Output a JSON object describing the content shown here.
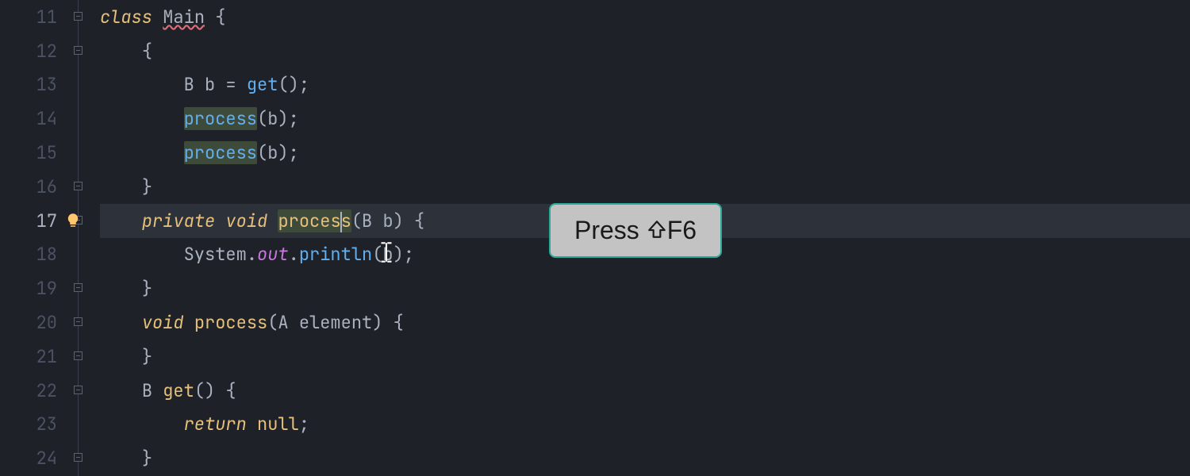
{
  "gutter": {
    "lines": [
      "11",
      "12",
      "13",
      "14",
      "15",
      "16",
      "17",
      "18",
      "19",
      "20",
      "21",
      "22",
      "23",
      "24"
    ]
  },
  "code": {
    "l11": {
      "kw_class": "class",
      "name": "Main",
      "brace": " {"
    },
    "l12": {
      "indent": "    ",
      "brace": "{"
    },
    "l13": {
      "indent": "        ",
      "type": "B",
      "sp1": " ",
      "var": "b",
      "eq": " = ",
      "call": "get",
      "rest": "();"
    },
    "l14": {
      "indent": "        ",
      "call": "process",
      "args": "(b);"
    },
    "l15": {
      "indent": "        ",
      "call": "process",
      "args": "(b);"
    },
    "l16": {
      "indent": "    ",
      "brace": "}"
    },
    "l17": {
      "indent": "    ",
      "kw_priv": "private",
      "sp1": " ",
      "kw_void": "void",
      "sp2": " ",
      "name_a": "proces",
      "name_b": "s",
      "params": "(B b) {"
    },
    "l18": {
      "indent": "        ",
      "sys": "System",
      "dot1": ".",
      "out": "out",
      "dot2": ".",
      "call": "println",
      "args": "(b);"
    },
    "l19": {
      "indent": "    ",
      "brace": "}"
    },
    "l20": {
      "indent": "    ",
      "kw_void": "void",
      "sp1": " ",
      "name": "process",
      "params": "(A element) {"
    },
    "l21": {
      "indent": "    ",
      "brace": "}"
    },
    "l22": {
      "indent": "    ",
      "type": "B",
      "sp1": " ",
      "name": "get",
      "params": "() {"
    },
    "l23": {
      "indent": "        ",
      "kw_return": "return",
      "sp1": " ",
      "null": "null",
      "semi": ";"
    },
    "l24": {
      "indent": "    ",
      "brace": "}"
    }
  },
  "hint": {
    "prefix": "Press ",
    "key": "F6"
  }
}
